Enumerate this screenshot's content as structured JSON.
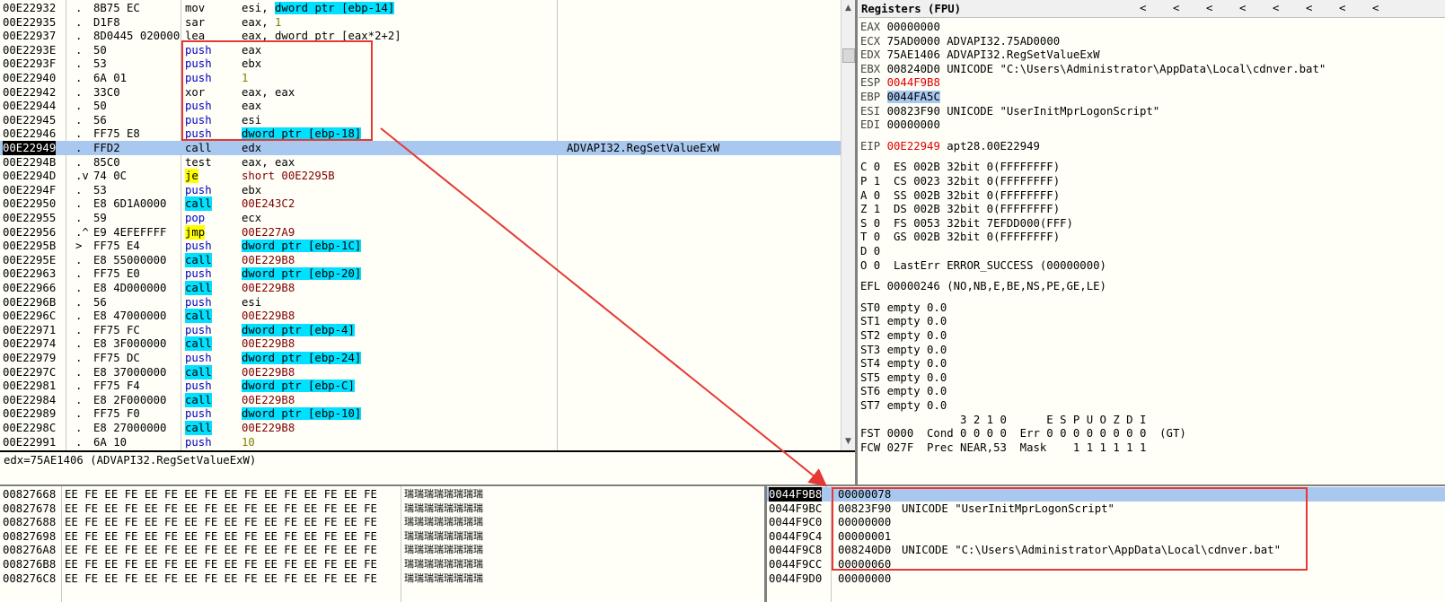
{
  "disasm": {
    "rows": [
      {
        "addr": "00E22932",
        "mark": ".",
        "bytes": "8B75 EC",
        "mn": "mov",
        "mk": "",
        "ops": [
          {
            "t": "esi, ",
            "c": ""
          },
          {
            "t": "dword ptr [ebp-14]",
            "c": "hl-mem"
          }
        ],
        "comment": ""
      },
      {
        "addr": "00E22935",
        "mark": ".",
        "bytes": "D1F8",
        "mn": "sar",
        "mk": "",
        "ops": [
          {
            "t": "eax, ",
            "c": ""
          },
          {
            "t": "1",
            "c": "num"
          }
        ],
        "comment": ""
      },
      {
        "addr": "00E22937",
        "mark": ".",
        "bytes": "8D0445 020000",
        "mn": "lea",
        "mk": "",
        "ops": [
          {
            "t": "eax, dword ptr [eax*2+2]",
            "c": ""
          }
        ],
        "comment": ""
      },
      {
        "addr": "00E2293E",
        "mark": ".",
        "bytes": "50",
        "mn": "push",
        "mk": "kw-push",
        "ops": [
          {
            "t": "eax",
            "c": ""
          }
        ],
        "comment": ""
      },
      {
        "addr": "00E2293F",
        "mark": ".",
        "bytes": "53",
        "mn": "push",
        "mk": "kw-push",
        "ops": [
          {
            "t": "ebx",
            "c": ""
          }
        ],
        "comment": ""
      },
      {
        "addr": "00E22940",
        "mark": ".",
        "bytes": "6A 01",
        "mn": "push",
        "mk": "kw-push",
        "ops": [
          {
            "t": "1",
            "c": "num"
          }
        ],
        "comment": ""
      },
      {
        "addr": "00E22942",
        "mark": ".",
        "bytes": "33C0",
        "mn": "xor",
        "mk": "",
        "ops": [
          {
            "t": "eax, eax",
            "c": ""
          }
        ],
        "comment": ""
      },
      {
        "addr": "00E22944",
        "mark": ".",
        "bytes": "50",
        "mn": "push",
        "mk": "kw-push",
        "ops": [
          {
            "t": "eax",
            "c": ""
          }
        ],
        "comment": ""
      },
      {
        "addr": "00E22945",
        "mark": ".",
        "bytes": "56",
        "mn": "push",
        "mk": "kw-push",
        "ops": [
          {
            "t": "esi",
            "c": ""
          }
        ],
        "comment": ""
      },
      {
        "addr": "00E22946",
        "mark": ".",
        "bytes": "FF75 E8",
        "mn": "push",
        "mk": "kw-push",
        "ops": [
          {
            "t": "dword ptr [ebp-18]",
            "c": "hl-mem"
          }
        ],
        "comment": ""
      },
      {
        "addr": "00E22949",
        "mark": ".",
        "bytes": "FFD2",
        "mn": "call",
        "mk": "",
        "ops": [
          {
            "t": "edx",
            "c": ""
          }
        ],
        "comment": "ADVAPI32.RegSetValueExW",
        "selected": true
      },
      {
        "addr": "00E2294B",
        "mark": ".",
        "bytes": "85C0",
        "mn": "test",
        "mk": "",
        "ops": [
          {
            "t": "eax, eax",
            "c": ""
          }
        ],
        "comment": ""
      },
      {
        "addr": "00E2294D",
        "mark": ".v",
        "bytes": "74 0C",
        "mn": "je",
        "mk": "kw-je",
        "ops": [
          {
            "t": "short 00E2295B",
            "c": "target"
          }
        ],
        "comment": ""
      },
      {
        "addr": "00E2294F",
        "mark": ".",
        "bytes": "53",
        "mn": "push",
        "mk": "kw-push",
        "ops": [
          {
            "t": "ebx",
            "c": ""
          }
        ],
        "comment": ""
      },
      {
        "addr": "00E22950",
        "mark": ".",
        "bytes": "E8 6D1A0000",
        "mn": "call",
        "mk": "kw-call",
        "ops": [
          {
            "t": "00E243C2",
            "c": "target"
          }
        ],
        "comment": ""
      },
      {
        "addr": "00E22955",
        "mark": ".",
        "bytes": "59",
        "mn": "pop",
        "mk": "kw-pop",
        "ops": [
          {
            "t": "ecx",
            "c": ""
          }
        ],
        "comment": ""
      },
      {
        "addr": "00E22956",
        "mark": ".^",
        "bytes": "E9 4EFEFFFF",
        "mn": "jmp",
        "mk": "kw-jmp",
        "ops": [
          {
            "t": "00E227A9",
            "c": "target"
          }
        ],
        "comment": ""
      },
      {
        "addr": "00E2295B",
        "mark": ">",
        "bytes": "FF75 E4",
        "mn": "push",
        "mk": "kw-push",
        "ops": [
          {
            "t": "dword ptr [ebp-1C]",
            "c": "hl-mem"
          }
        ],
        "comment": ""
      },
      {
        "addr": "00E2295E",
        "mark": ".",
        "bytes": "E8 55000000",
        "mn": "call",
        "mk": "kw-call",
        "ops": [
          {
            "t": "00E229B8",
            "c": "target"
          }
        ],
        "comment": ""
      },
      {
        "addr": "00E22963",
        "mark": ".",
        "bytes": "FF75 E0",
        "mn": "push",
        "mk": "kw-push",
        "ops": [
          {
            "t": "dword ptr [ebp-20]",
            "c": "hl-mem"
          }
        ],
        "comment": ""
      },
      {
        "addr": "00E22966",
        "mark": ".",
        "bytes": "E8 4D000000",
        "mn": "call",
        "mk": "kw-call",
        "ops": [
          {
            "t": "00E229B8",
            "c": "target"
          }
        ],
        "comment": ""
      },
      {
        "addr": "00E2296B",
        "mark": ".",
        "bytes": "56",
        "mn": "push",
        "mk": "kw-push",
        "ops": [
          {
            "t": "esi",
            "c": ""
          }
        ],
        "comment": ""
      },
      {
        "addr": "00E2296C",
        "mark": ".",
        "bytes": "E8 47000000",
        "mn": "call",
        "mk": "kw-call",
        "ops": [
          {
            "t": "00E229B8",
            "c": "target"
          }
        ],
        "comment": ""
      },
      {
        "addr": "00E22971",
        "mark": ".",
        "bytes": "FF75 FC",
        "mn": "push",
        "mk": "kw-push",
        "ops": [
          {
            "t": "dword ptr [ebp-4]",
            "c": "hl-mem"
          }
        ],
        "comment": ""
      },
      {
        "addr": "00E22974",
        "mark": ".",
        "bytes": "E8 3F000000",
        "mn": "call",
        "mk": "kw-call",
        "ops": [
          {
            "t": "00E229B8",
            "c": "target"
          }
        ],
        "comment": ""
      },
      {
        "addr": "00E22979",
        "mark": ".",
        "bytes": "FF75 DC",
        "mn": "push",
        "mk": "kw-push",
        "ops": [
          {
            "t": "dword ptr [ebp-24]",
            "c": "hl-mem"
          }
        ],
        "comment": ""
      },
      {
        "addr": "00E2297C",
        "mark": ".",
        "bytes": "E8 37000000",
        "mn": "call",
        "mk": "kw-call",
        "ops": [
          {
            "t": "00E229B8",
            "c": "target"
          }
        ],
        "comment": ""
      },
      {
        "addr": "00E22981",
        "mark": ".",
        "bytes": "FF75 F4",
        "mn": "push",
        "mk": "kw-push",
        "ops": [
          {
            "t": "dword ptr [ebp-C]",
            "c": "hl-mem"
          }
        ],
        "comment": ""
      },
      {
        "addr": "00E22984",
        "mark": ".",
        "bytes": "E8 2F000000",
        "mn": "call",
        "mk": "kw-call",
        "ops": [
          {
            "t": "00E229B8",
            "c": "target"
          }
        ],
        "comment": ""
      },
      {
        "addr": "00E22989",
        "mark": ".",
        "bytes": "FF75 F0",
        "mn": "push",
        "mk": "kw-push",
        "ops": [
          {
            "t": "dword ptr [ebp-10]",
            "c": "hl-mem"
          }
        ],
        "comment": ""
      },
      {
        "addr": "00E2298C",
        "mark": ".",
        "bytes": "E8 27000000",
        "mn": "call",
        "mk": "kw-call",
        "ops": [
          {
            "t": "00E229B8",
            "c": "target"
          }
        ],
        "comment": ""
      },
      {
        "addr": "00E22991",
        "mark": ".",
        "bytes": "6A 10",
        "mn": "push",
        "mk": "kw-push",
        "ops": [
          {
            "t": "10",
            "c": "num"
          }
        ],
        "comment": ""
      }
    ]
  },
  "info": {
    "text": "edx=75AE1406 (ADVAPI32.RegSetValueExW)"
  },
  "registers": {
    "title": "Registers (FPU)",
    "nav": [
      "<",
      "<",
      "<",
      "<",
      "<",
      "<",
      "<",
      "<"
    ],
    "gp": [
      {
        "name": "EAX",
        "val": "00000000",
        "note": "",
        "cls": ""
      },
      {
        "name": "ECX",
        "val": "75AD0000",
        "note": "ADVAPI32.75AD0000",
        "cls": ""
      },
      {
        "name": "EDX",
        "val": "75AE1406",
        "note": "ADVAPI32.RegSetValueExW",
        "cls": ""
      },
      {
        "name": "EBX",
        "val": "008240D0",
        "note": "UNICODE \"C:\\Users\\Administrator\\AppData\\Local\\cdnver.bat\"",
        "cls": ""
      },
      {
        "name": "ESP",
        "val": "0044F9B8",
        "note": "",
        "cls": "reg-red"
      },
      {
        "name": "EBP",
        "val": "0044FA5C",
        "note": "",
        "cls": "sel-row"
      },
      {
        "name": "ESI",
        "val": "00823F90",
        "note": "UNICODE \"UserInitMprLogonScript\"",
        "cls": ""
      },
      {
        "name": "EDI",
        "val": "00000000",
        "note": "",
        "cls": ""
      }
    ],
    "eip": {
      "name": "EIP",
      "val": "00E22949",
      "note": "apt28.00E22949"
    },
    "flags": [
      "C 0  ES 002B 32bit 0(FFFFFFFF)",
      "P 1  CS 0023 32bit 0(FFFFFFFF)",
      "A 0  SS 002B 32bit 0(FFFFFFFF)",
      "Z 1  DS 002B 32bit 0(FFFFFFFF)",
      "S 0  FS 0053 32bit 7EFDD000(FFF)",
      "T 0  GS 002B 32bit 0(FFFFFFFF)",
      "D 0",
      "O 0  LastErr ERROR_SUCCESS (00000000)"
    ],
    "efl": "EFL 00000246 (NO,NB,E,BE,NS,PE,GE,LE)",
    "st": [
      "ST0 empty 0.0",
      "ST1 empty 0.0",
      "ST2 empty 0.0",
      "ST3 empty 0.0",
      "ST4 empty 0.0",
      "ST5 empty 0.0",
      "ST6 empty 0.0",
      "ST7 empty 0.0"
    ],
    "fpu_hdr": "               3 2 1 0      E S P U O Z D I",
    "fst": "FST 0000  Cond 0 0 0 0  Err 0 0 0 0 0 0 0 0  (GT)",
    "fcw": "FCW 027F  Prec NEAR,53  Mask    1 1 1 1 1 1"
  },
  "dump": {
    "rows": [
      {
        "addr": "00827668",
        "hex": "EE FE EE FE EE FE EE FE EE FE EE FE EE FE EE FE",
        "ascii": "瑞瑞瑞瑞瑞瑞瑞瑞"
      },
      {
        "addr": "00827678",
        "hex": "EE FE EE FE EE FE EE FE EE FE EE FE EE FE EE FE",
        "ascii": "瑞瑞瑞瑞瑞瑞瑞瑞"
      },
      {
        "addr": "00827688",
        "hex": "EE FE EE FE EE FE EE FE EE FE EE FE EE FE EE FE",
        "ascii": "瑞瑞瑞瑞瑞瑞瑞瑞"
      },
      {
        "addr": "00827698",
        "hex": "EE FE EE FE EE FE EE FE EE FE EE FE EE FE EE FE",
        "ascii": "瑞瑞瑞瑞瑞瑞瑞瑞"
      },
      {
        "addr": "008276A8",
        "hex": "EE FE EE FE EE FE EE FE EE FE EE FE EE FE EE FE",
        "ascii": "瑞瑞瑞瑞瑞瑞瑞瑞"
      },
      {
        "addr": "008276B8",
        "hex": "EE FE EE FE EE FE EE FE EE FE EE FE EE FE EE FE",
        "ascii": "瑞瑞瑞瑞瑞瑞瑞瑞"
      },
      {
        "addr": "008276C8",
        "hex": "EE FE EE FE EE FE EE FE EE FE EE FE EE FE EE FE",
        "ascii": "瑞瑞瑞瑞瑞瑞瑞瑞"
      }
    ]
  },
  "stack": {
    "rows": [
      {
        "addr": "0044F9B8",
        "val": "00000078",
        "note": "",
        "sel": true
      },
      {
        "addr": "0044F9BC",
        "val": "00823F90",
        "note": "UNICODE \"UserInitMprLogonScript\""
      },
      {
        "addr": "0044F9C0",
        "val": "00000000",
        "note": ""
      },
      {
        "addr": "0044F9C4",
        "val": "00000001",
        "note": ""
      },
      {
        "addr": "0044F9C8",
        "val": "008240D0",
        "note": "UNICODE \"C:\\Users\\Administrator\\AppData\\Local\\cdnver.bat\""
      },
      {
        "addr": "0044F9CC",
        "val": "00000060",
        "note": ""
      },
      {
        "addr": "0044F9D0",
        "val": "00000000",
        "note": ""
      }
    ]
  },
  "colors": {
    "annotation": "#e53935",
    "selection": "#a9c8f0",
    "call_bg": "#00e0ff",
    "jump_bg": "#ffff00"
  }
}
